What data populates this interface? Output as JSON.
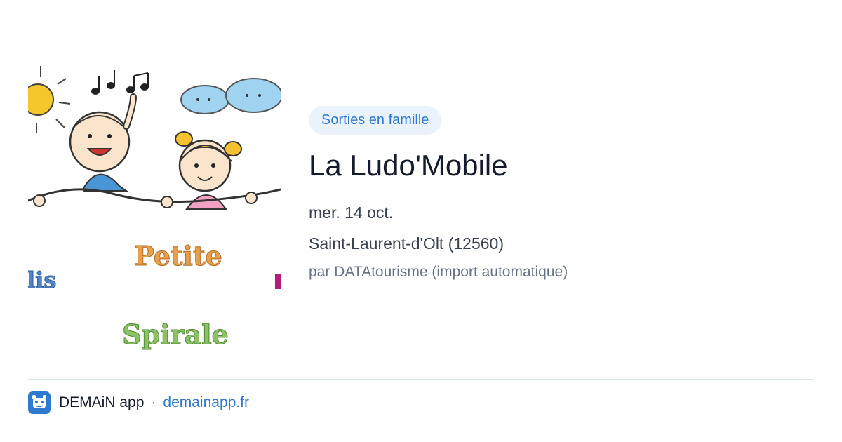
{
  "event": {
    "category": "Sorties en famille",
    "title": "La Ludo'Mobile",
    "date": "mer. 14 oct.",
    "location": "Saint-Laurent-d'Olt (12560)",
    "source": "par DATAtourisme (import automatique)"
  },
  "image": {
    "word_1": "Petite",
    "word_2": "Spirale",
    "fragment_left": "lis"
  },
  "footer": {
    "app_name": "DEMAiN app",
    "separator": "·",
    "link": "demainapp.fr"
  },
  "colors": {
    "accent": "#2f7ad0",
    "tag_background": "#eaf2fc",
    "title": "#141b2b",
    "muted": "#687284"
  }
}
